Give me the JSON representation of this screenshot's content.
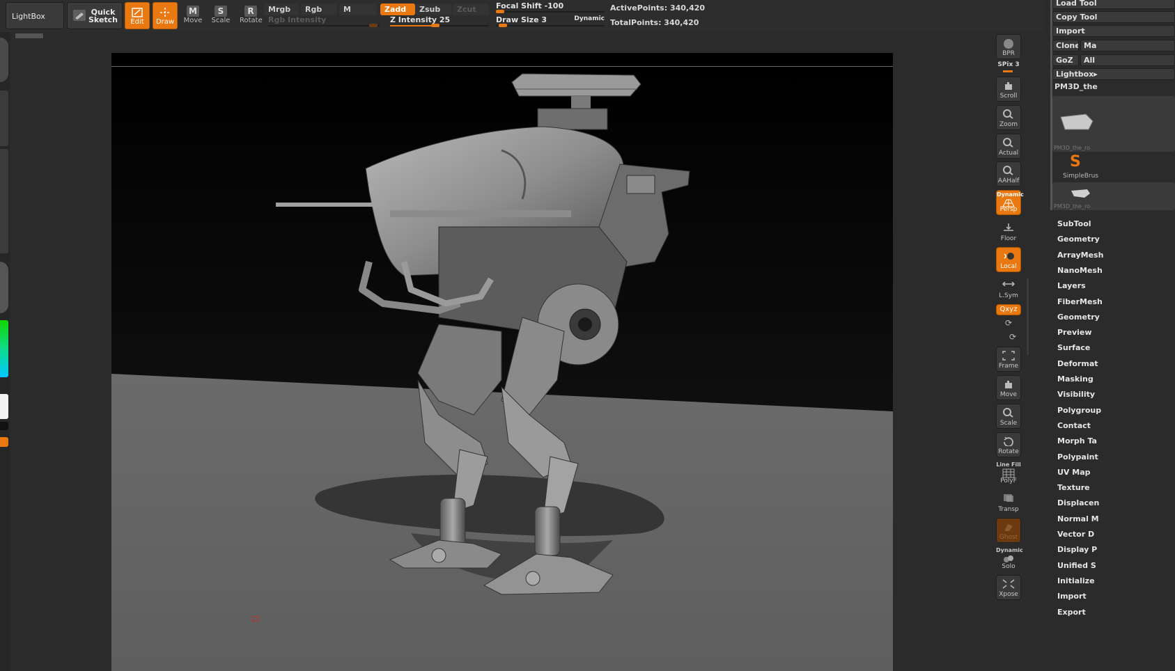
{
  "toolbar": {
    "lightbox": "LightBox",
    "quick_sketch_line1": "Quick",
    "quick_sketch_line2": "Sketch",
    "edit": "Edit",
    "draw": "Draw",
    "move": "Move",
    "scale": "Scale",
    "rotate": "Rotate",
    "move_glyph": "M",
    "scale_glyph": "S",
    "rotate_glyph": "R"
  },
  "color_modes": {
    "mrgb": "Mrgb",
    "rgb": "Rgb",
    "m": "M",
    "rgb_intensity": "Rgb Intensity"
  },
  "sculpt_modes": {
    "zadd": "Zadd",
    "zsub": "Zsub",
    "zcut": "Zcut",
    "z_intensity": "Z Intensity 25",
    "z_intensity_value": 25
  },
  "brush": {
    "focal_shift": "Focal Shift -100",
    "focal_shift_value": -100,
    "draw_size": "Draw Size 3",
    "draw_size_value": 3,
    "dynamic": "Dynamic"
  },
  "stats": {
    "active_points": "ActivePoints: 340,420",
    "total_points": "TotalPoints: 340,420"
  },
  "right_shelf": {
    "bpr": "BPR",
    "spix": "SPix 3",
    "scroll": "Scroll",
    "zoom": "Zoom",
    "actual": "Actual",
    "aahalf": "AAHalf",
    "persp_top": "Dynamic",
    "persp": "Persp",
    "floor": "Floor",
    "local": "Local",
    "lsym": "L.Sym",
    "xyz": "Qxyz",
    "frame": "Frame",
    "move": "Move",
    "scale": "Scale",
    "rotate": "Rotate",
    "polyf_top": "Line Fill",
    "polyf": "PolyF",
    "transp": "Transp",
    "ghost": "Ghost",
    "solo_top": "Dynamic",
    "solo": "Solo",
    "xpose": "Xpose"
  },
  "tool_panel": {
    "load_tool": "Load Tool",
    "copy_tool": "Copy Tool",
    "import": "Import",
    "clone": "Clone",
    "make": "Ma",
    "goz": "GoZ",
    "all": "All",
    "lightbox_tools": "Lightbox▸",
    "current_tool": "PM3D_the",
    "thumb1_caption": "PM3D_the_ro",
    "simplebrush": "SimpleBrus",
    "thumb3_caption": "PM3D_the_ro",
    "menus": [
      "SubTool",
      "Geometry",
      "ArrayMesh",
      "NanoMesh",
      "Layers",
      "FiberMesh",
      "Geometry",
      "Preview",
      "Surface",
      "Deformat",
      "Masking",
      "Visibility",
      "Polygroup",
      "Contact",
      "Morph Ta",
      "Polypaint",
      "UV Map",
      "Texture",
      "Displacen",
      "Normal M",
      "Vector D",
      "Display P",
      "Unified S",
      "Initialize",
      "Import",
      "Export"
    ]
  },
  "colors": {
    "accent": "#e8780f",
    "panel": "#2b2b2b",
    "button": "#3a3a3a"
  }
}
